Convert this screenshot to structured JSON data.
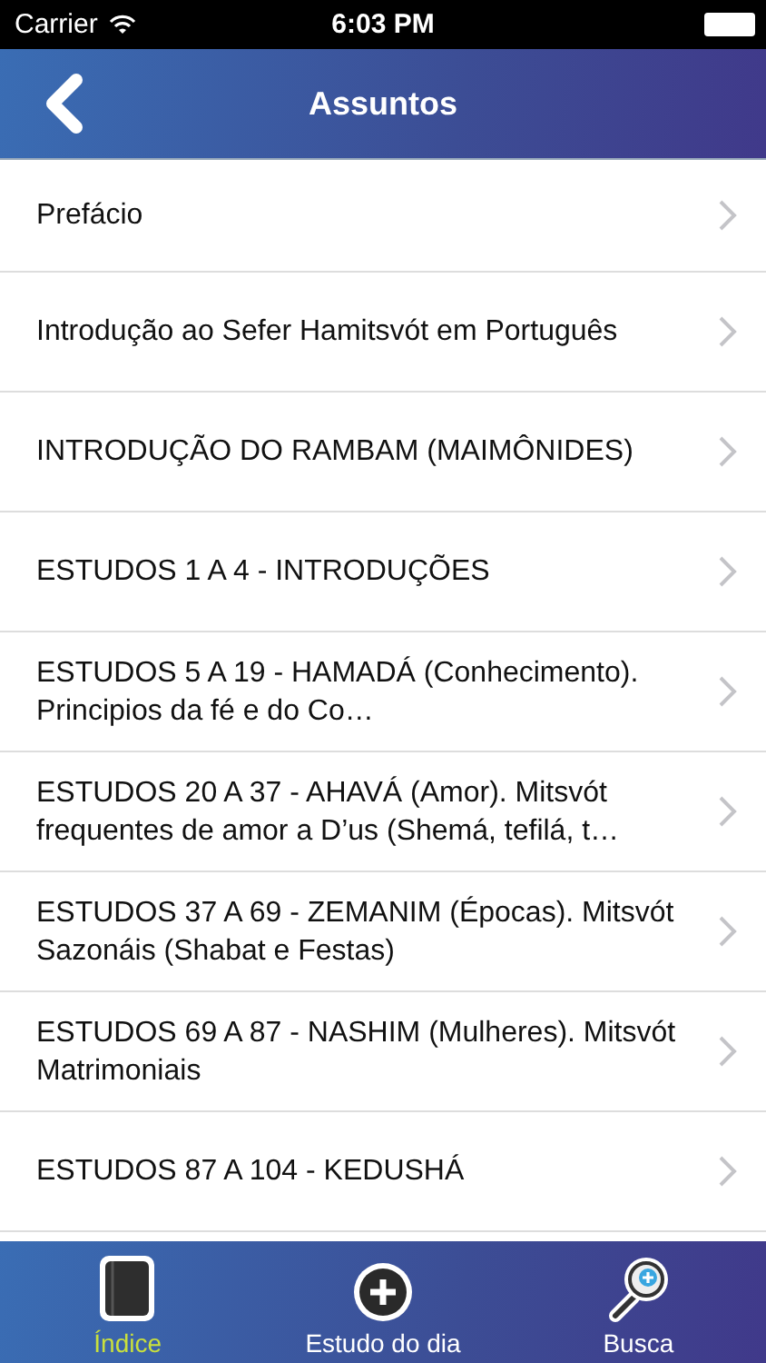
{
  "status_bar": {
    "carrier": "Carrier",
    "time": "6:03 PM"
  },
  "nav_bar": {
    "title": "Assuntos"
  },
  "items": [
    {
      "title": "Prefácio"
    },
    {
      "title": "Introdução ao Sefer Hamitsvót em Português"
    },
    {
      "title": "INTRODUÇÃO DO RAMBAM (MAIMÔNIDES)"
    },
    {
      "title": "ESTUDOS 1 A 4 - INTRODUÇÕES"
    },
    {
      "title": "ESTUDOS 5 A 19 - HAMADÁ (Conhecimento). Principios da fé e do Co…"
    },
    {
      "title": "ESTUDOS 20 A 37 - AHAVÁ (Amor). Mitsvót frequentes de amor a D’us (Shemá, tefilá, t…"
    },
    {
      "title": "ESTUDOS 37 A 69 - ZEMANIM (Épocas). Mitsvót Sazonáis (Shabat e Festas)"
    },
    {
      "title": "ESTUDOS 69 A 87 - NASHIM (Mulheres). Mitsvót Matrimoniais"
    },
    {
      "title": "ESTUDOS 87 A 104 - KEDUSHÁ"
    }
  ],
  "tab_bar": [
    {
      "label": "Índice",
      "kind": "book",
      "selected": true
    },
    {
      "label": "Estudo do dia",
      "kind": "plus",
      "selected": false
    },
    {
      "label": "Busca",
      "kind": "search",
      "selected": false
    }
  ]
}
